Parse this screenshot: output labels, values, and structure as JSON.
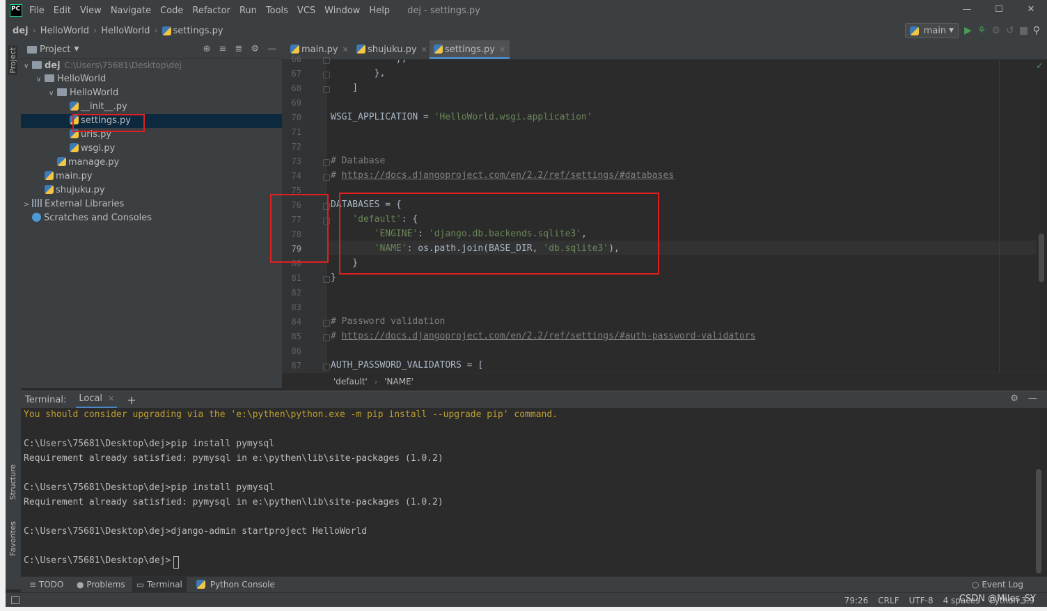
{
  "app": {
    "logo_text": "PC",
    "menu": [
      "File",
      "Edit",
      "View",
      "Navigate",
      "Code",
      "Refactor",
      "Run",
      "Tools",
      "VCS",
      "Window",
      "Help"
    ],
    "window_title": "dej - settings.py"
  },
  "navbar": {
    "crumbs": [
      "dej",
      "HelloWorld",
      "HelloWorld",
      "settings.py"
    ],
    "run_config": "main"
  },
  "project": {
    "title": "Project",
    "tree": [
      {
        "label": "dej",
        "hint": "C:\\Users\\75681\\Desktop\\dej"
      },
      {
        "label": "HelloWorld"
      },
      {
        "label": "HelloWorld"
      },
      {
        "label": "__init__.py"
      },
      {
        "label": "settings.py"
      },
      {
        "label": "urls.py"
      },
      {
        "label": "wsgi.py"
      },
      {
        "label": "manage.py"
      },
      {
        "label": "main.py"
      },
      {
        "label": "shujuku.py"
      },
      {
        "label": "External Libraries"
      },
      {
        "label": "Scratches and Consoles"
      }
    ]
  },
  "left_strip": {
    "project": "Project",
    "structure": "Structure",
    "favorites": "Favorites"
  },
  "tabs": [
    {
      "label": "main.py",
      "active": false
    },
    {
      "label": "shujuku.py",
      "active": false
    },
    {
      "label": "settings.py",
      "active": true
    }
  ],
  "editor": {
    "lines": [
      {
        "n": "66",
        "code": "            },"
      },
      {
        "n": "67",
        "code": "        },"
      },
      {
        "n": "68",
        "code": "    ]"
      },
      {
        "n": "69",
        "code": ""
      },
      {
        "n": "70",
        "code": "WSGI_APPLICATION = ",
        "str": "'HelloWorld.wsgi.application'"
      },
      {
        "n": "71",
        "code": ""
      },
      {
        "n": "72",
        "code": ""
      },
      {
        "n": "73",
        "comment": "# Database"
      },
      {
        "n": "74",
        "comment": "# ",
        "url": "https://docs.djangoproject.com/en/2.2/ref/settings/#databases"
      },
      {
        "n": "75",
        "code": ""
      },
      {
        "n": "76",
        "code": "DATABASES = {"
      },
      {
        "n": "77",
        "code": "    ",
        "str": "'default'",
        "rest": ": {"
      },
      {
        "n": "78",
        "code": "        ",
        "str": "'ENGINE'",
        "rest": ": ",
        "str2": "'django.db.backends.sqlite3'",
        "rest2": ","
      },
      {
        "n": "79",
        "code": "        ",
        "str": "'NAME'",
        "rest": ": os.path.join(BASE_DIR, ",
        "str2": "'db.sqlite3'",
        "rest2": "),"
      },
      {
        "n": "80",
        "code": "    }"
      },
      {
        "n": "81",
        "code": "}"
      },
      {
        "n": "82",
        "code": ""
      },
      {
        "n": "83",
        "code": ""
      },
      {
        "n": "84",
        "comment": "# Password validation"
      },
      {
        "n": "85",
        "comment": "# ",
        "url": "https://docs.djangoproject.com/en/2.2/ref/settings/#auth-password-validators"
      },
      {
        "n": "86",
        "code": ""
      },
      {
        "n": "87",
        "code": "AUTH_PASSWORD_VALIDATORS = ["
      }
    ],
    "breadcrumb": [
      "'default'",
      "'NAME'"
    ]
  },
  "terminal": {
    "label": "Terminal:",
    "tab": "Local",
    "lines": [
      {
        "text": "You should consider upgrading via the 'e:\\pythen\\python.exe -m pip install --upgrade pip' command.",
        "warn": true
      },
      {
        "text": ""
      },
      {
        "text": "C:\\Users\\75681\\Desktop\\dej>pip install pymysql"
      },
      {
        "text": "Requirement already satisfied: pymysql in e:\\pythen\\lib\\site-packages (1.0.2)"
      },
      {
        "text": ""
      },
      {
        "text": "C:\\Users\\75681\\Desktop\\dej>pip install pymysql"
      },
      {
        "text": "Requirement already satisfied: pymysql in e:\\pythen\\lib\\site-packages (1.0.2)"
      },
      {
        "text": ""
      },
      {
        "text": "C:\\Users\\75681\\Desktop\\dej>django-admin startproject HelloWorld"
      },
      {
        "text": ""
      },
      {
        "text": "C:\\Users\\75681\\Desktop\\dej>"
      }
    ]
  },
  "bottom_tools": [
    "TODO",
    "Problems",
    "Terminal",
    "Python Console"
  ],
  "event_log": "Event Log",
  "status": {
    "position": "79:26",
    "line_sep": "CRLF",
    "encoding": "UTF-8",
    "indent": "4 spaces",
    "interpreter": "Python 3.9",
    "watermark": "CSDN @Miles_SY"
  },
  "colors": {
    "accent": "#4a88c7",
    "highlight_box": "#e02020",
    "run_green": "#499c54"
  }
}
